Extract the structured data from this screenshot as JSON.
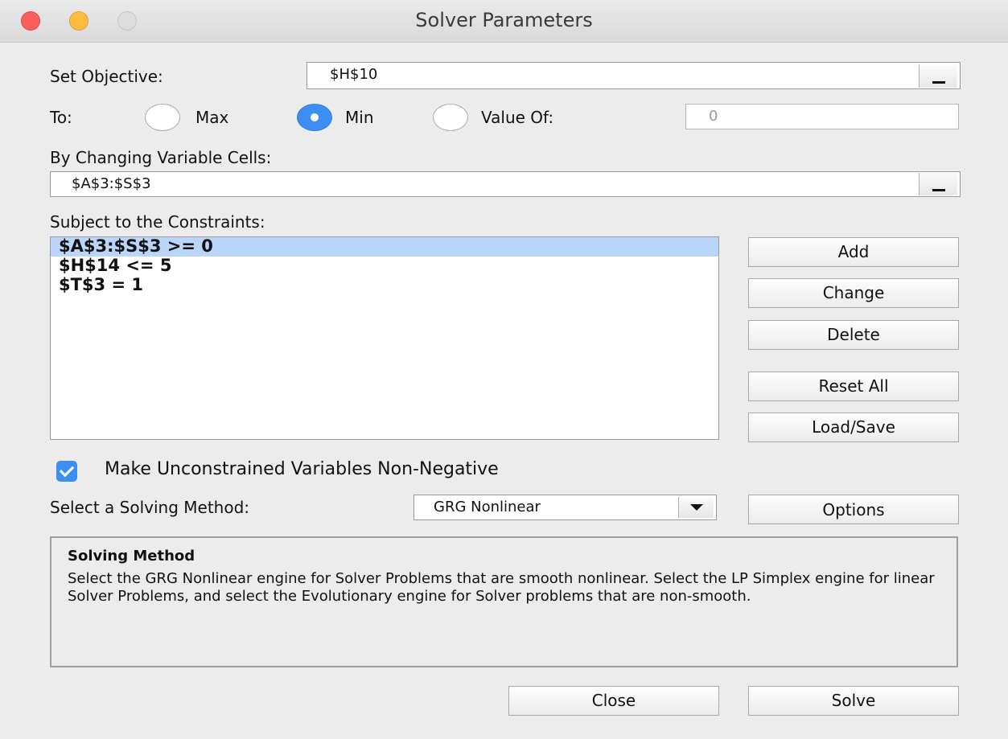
{
  "window": {
    "title": "Solver Parameters"
  },
  "objective": {
    "label": "Set Objective:",
    "value": "$H$10"
  },
  "to": {
    "label": "To:",
    "options": {
      "max": "Max",
      "min": "Min",
      "value_of": "Value Of:"
    },
    "selected": "Min",
    "value_of_input": "0"
  },
  "variables": {
    "label": "By Changing Variable Cells:",
    "value": "$A$3:$S$3"
  },
  "constraints": {
    "label": "Subject to the Constraints:",
    "items": [
      "$A$3:$S$3 >= 0",
      "$H$14 <= 5",
      "$T$3 = 1"
    ],
    "selected_index": 0
  },
  "buttons": {
    "add": "Add",
    "change": "Change",
    "delete": "Delete",
    "reset_all": "Reset All",
    "load_save": "Load/Save",
    "options": "Options",
    "close": "Close",
    "solve": "Solve"
  },
  "nonnegative": {
    "label": "Make Unconstrained Variables Non-Negative",
    "checked": true
  },
  "method": {
    "label": "Select a Solving Method:",
    "value": "GRG Nonlinear"
  },
  "method_info": {
    "title": "Solving Method",
    "description": "Select the GRG Nonlinear engine for Solver Problems that are smooth nonlinear. Select the LP Simplex engine for linear Solver Problems, and select the Evolutionary engine for Solver problems that are non-smooth."
  },
  "colors": {
    "accent": "#3d8ef3",
    "selection": "#b9d5fa"
  }
}
